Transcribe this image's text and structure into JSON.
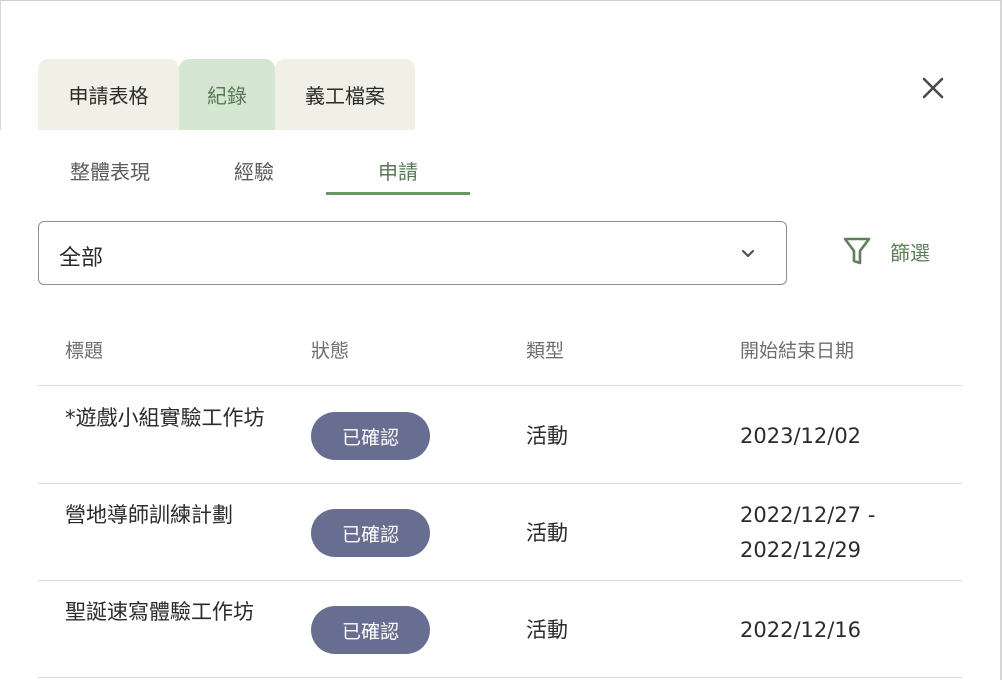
{
  "tabs": [
    {
      "label": "申請表格"
    },
    {
      "label": "紀錄"
    },
    {
      "label": "義工檔案"
    }
  ],
  "subtabs": [
    {
      "label": "整體表現"
    },
    {
      "label": "經驗"
    },
    {
      "label": "申請"
    }
  ],
  "filter_select": {
    "value": "全部"
  },
  "filter_button": {
    "label": "篩選"
  },
  "table": {
    "headers": [
      "標題",
      "狀態",
      "類型",
      "開始結束日期"
    ],
    "rows": [
      {
        "title": "*遊戲小組實驗工作坊",
        "status": "已確認",
        "type": "活動",
        "date": "2023/12/02"
      },
      {
        "title": "營地導師訓練計劃",
        "status": "已確認",
        "type": "活動",
        "date": "2022/12/27 - 2022/12/29"
      },
      {
        "title": "聖誕速寫體驗工作坊",
        "status": "已確認",
        "type": "活動",
        "date": "2022/12/16"
      }
    ]
  },
  "icons": {
    "close": "close-icon",
    "chevron": "chevron-down-icon",
    "filter": "filter-funnel-icon"
  },
  "colors": {
    "active_tab_bg": "#d5e7d2",
    "tab_bg": "#f0f0e6",
    "accent_green": "#5d8259",
    "badge_bg": "#686e92"
  }
}
